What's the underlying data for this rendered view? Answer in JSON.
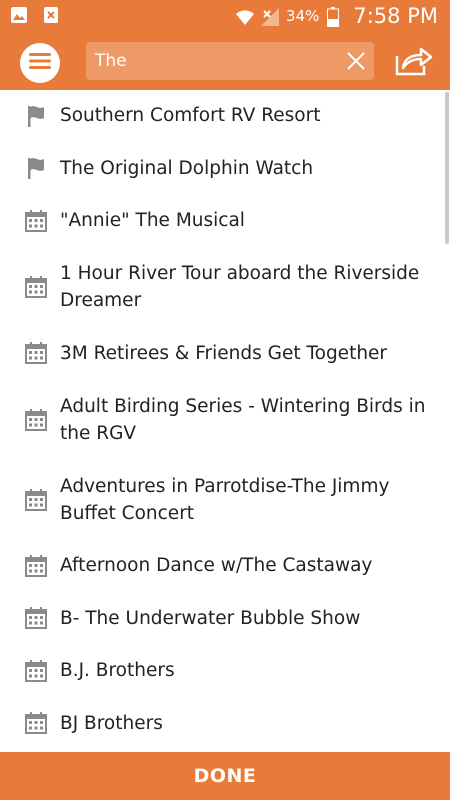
{
  "status_bar": {
    "battery_percent": "34%",
    "time": "7:58 PM"
  },
  "toolbar": {
    "search_value": "The",
    "menu_icon": "menu-icon",
    "clear_icon": "close-icon",
    "share_icon": "share-icon"
  },
  "results": [
    {
      "label": "Southern Comfort RV Resort",
      "icon": "flag-icon"
    },
    {
      "label": "The Original Dolphin Watch",
      "icon": "flag-icon"
    },
    {
      "label": "\"Annie\" The Musical",
      "icon": "calendar-icon"
    },
    {
      "label": "1 Hour River Tour aboard the Riverside Dreamer",
      "icon": "calendar-icon"
    },
    {
      "label": "3M Retirees & Friends Get Together",
      "icon": "calendar-icon"
    },
    {
      "label": "Adult Birding Series - Wintering Birds in the RGV",
      "icon": "calendar-icon"
    },
    {
      "label": "Adventures in Parrotdise-The Jimmy Buffet Concert",
      "icon": "calendar-icon"
    },
    {
      "label": "Afternoon Dance w/The Castaway",
      "icon": "calendar-icon"
    },
    {
      "label": "B- The Underwater Bubble Show",
      "icon": "calendar-icon"
    },
    {
      "label": "B.J. Brothers",
      "icon": "calendar-icon"
    },
    {
      "label": "BJ Brothers",
      "icon": "calendar-icon"
    }
  ],
  "footer": {
    "done_label": "DONE"
  },
  "colors": {
    "accent": "#e87a3a",
    "icon_gray": "#8a8a8a"
  }
}
